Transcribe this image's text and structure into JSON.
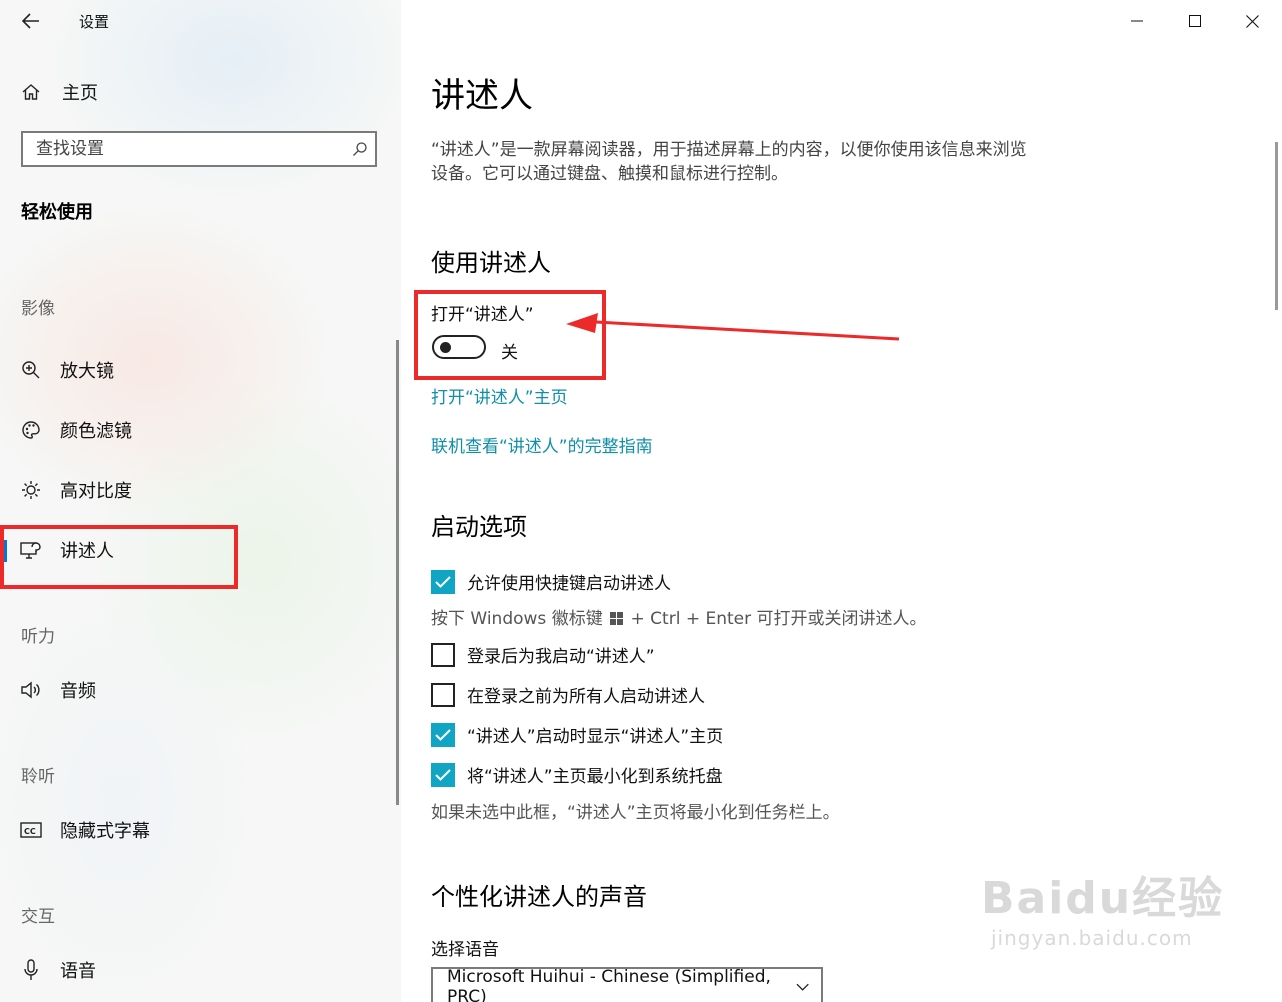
{
  "window": {
    "app_title": "设置"
  },
  "sidebar": {
    "home_label": "主页",
    "search_placeholder": "查找设置",
    "section_title": "轻松使用",
    "groups": {
      "vision": "影像",
      "hearing": "听力",
      "hearing2": "聆听",
      "interaction": "交互"
    },
    "items": {
      "magnifier": "放大镜",
      "color_filters": "颜色滤镜",
      "high_contrast": "高对比度",
      "narrator": "讲述人",
      "audio": "音频",
      "captions": "隐藏式字幕",
      "speech": "语音"
    }
  },
  "content": {
    "title": "讲述人",
    "description": "“讲述人”是一款屏幕阅读器，用于描述屏幕上的内容，以便你使用该信息来浏览设备。它可以通过键盘、触摸和鼠标进行控制。",
    "use_narrator": {
      "heading": "使用讲述人",
      "toggle_label": "打开“讲述人”",
      "toggle_state": "关",
      "toggle_on": false,
      "link_home": "打开“讲述人”主页",
      "link_guide": "联机查看“讲述人”的完整指南"
    },
    "startup": {
      "heading": "启动选项",
      "shortcut": {
        "label": "允许使用快捷键启动讲述人",
        "checked": true
      },
      "shortcut_hint_pre": "按下 Windows 徽标键",
      "shortcut_hint_post": "+ Ctrl + Enter 可打开或关闭讲述人。",
      "after_signin": {
        "label": "登录后为我启动“讲述人”",
        "checked": false
      },
      "before_signin": {
        "label": "在登录之前为所有人启动讲述人",
        "checked": false
      },
      "show_home": {
        "label": "“讲述人”启动时显示“讲述人”主页",
        "checked": true
      },
      "minimize_tray": {
        "label": "将“讲述人”主页最小化到系统托盘",
        "checked": true
      },
      "minimize_hint": "如果未选中此框，“讲述人”主页将最小化到任务栏上。"
    },
    "voice": {
      "heading": "个性化讲述人的声音",
      "select_label": "选择语音",
      "selected_voice": "Microsoft Huihui - Chinese (Simplified, PRC)"
    }
  },
  "watermark": {
    "main": "Baidu经验",
    "sub": "jingyan.baidu.com"
  },
  "colors": {
    "accent": "#0078d7",
    "link": "#0f8fa8",
    "checkbox": "#10a5c5",
    "annotation_red": "#ec2a2a"
  }
}
